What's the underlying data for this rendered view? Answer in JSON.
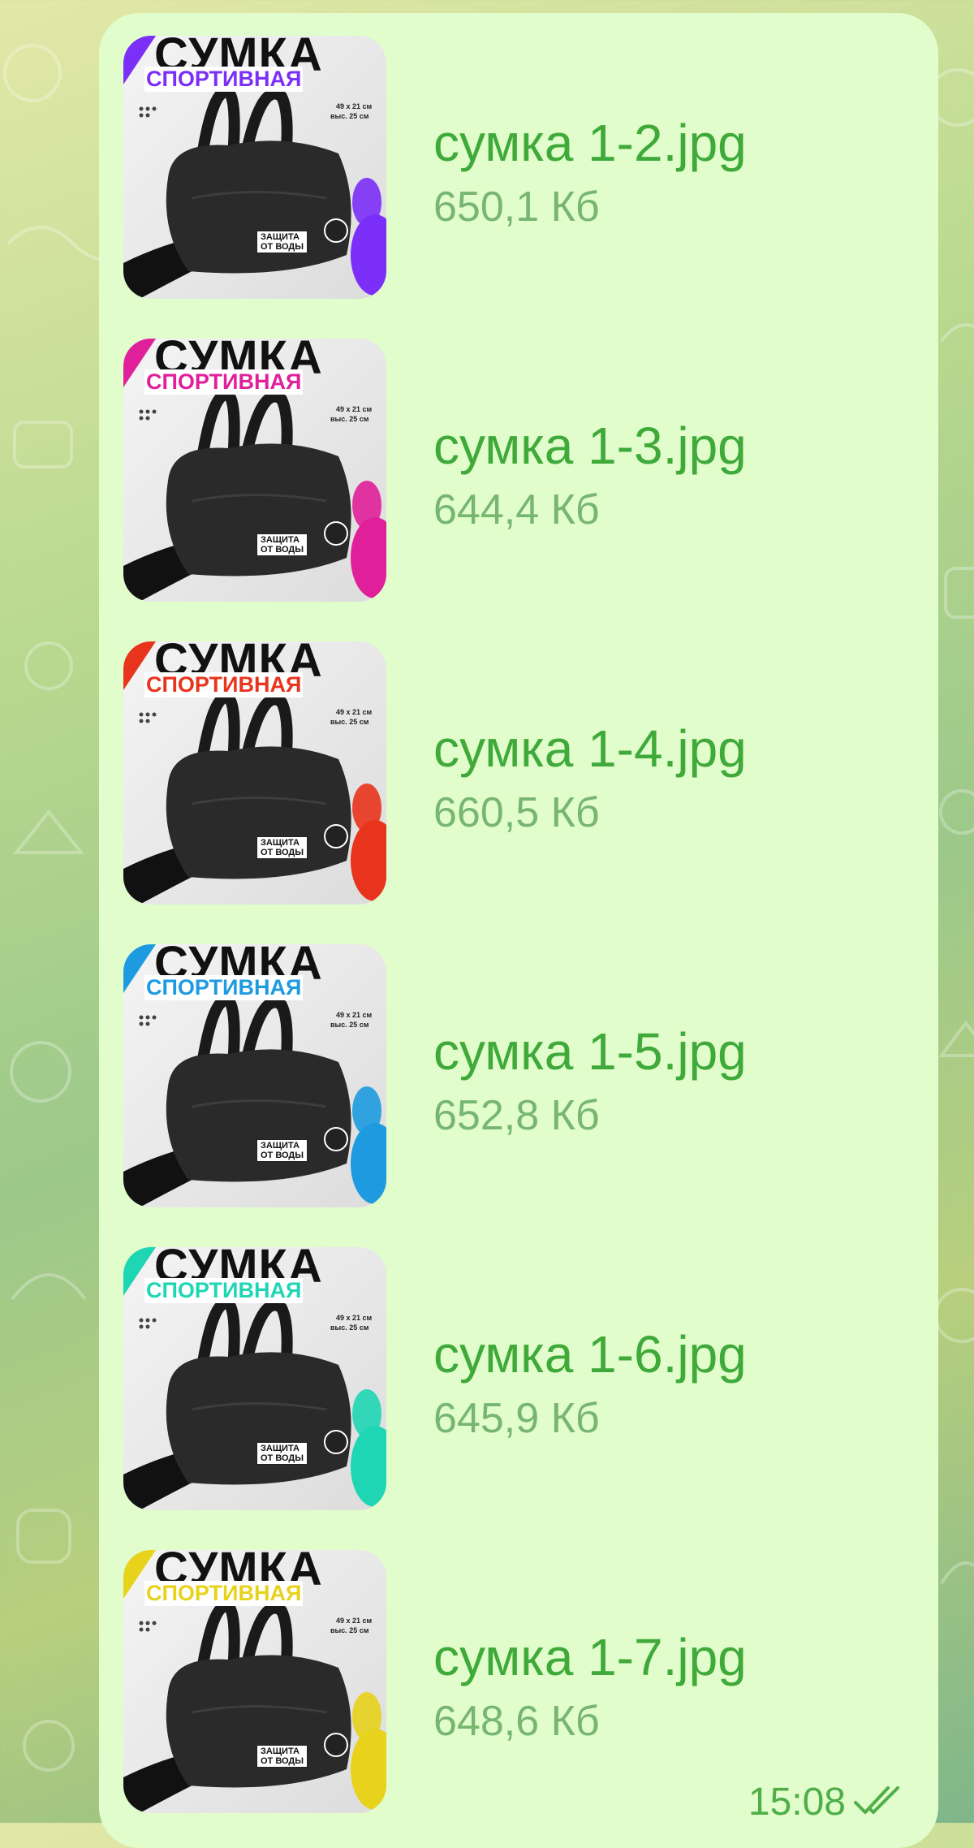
{
  "message": {
    "time": "15:08",
    "status_icon": "double-check-icon",
    "files": [
      {
        "name": "сумка 1-2.jpg",
        "size": "650,1 Кб",
        "thumb_title": "СУМКА",
        "thumb_subtitle": "СПОРТИВНАЯ",
        "thumb_dims": "49 x 21 см",
        "thumb_height": "выс. 25 см",
        "thumb_badge_1": "ЗАЩИТА",
        "thumb_badge_2": "ОТ ВОДЫ",
        "accent": "#7b2ff7"
      },
      {
        "name": "сумка 1-3.jpg",
        "size": "644,4 Кб",
        "thumb_title": "СУМКА",
        "thumb_subtitle": "СПОРТИВНАЯ",
        "thumb_dims": "49 x 21 см",
        "thumb_height": "выс. 25 см",
        "thumb_badge_1": "ЗАЩИТА",
        "thumb_badge_2": "ОТ ВОДЫ",
        "accent": "#e0209a"
      },
      {
        "name": "сумка 1-4.jpg",
        "size": "660,5 Кб",
        "thumb_title": "СУМКА",
        "thumb_subtitle": "СПОРТИВНАЯ",
        "thumb_dims": "49 x 21 см",
        "thumb_height": "выс. 25 см",
        "thumb_badge_1": "ЗАЩИТА",
        "thumb_badge_2": "ОТ ВОДЫ",
        "accent": "#e8341c"
      },
      {
        "name": "сумка 1-5.jpg",
        "size": "652,8 Кб",
        "thumb_title": "СУМКА",
        "thumb_subtitle": "СПОРТИВНАЯ",
        "thumb_dims": "49 x 21 см",
        "thumb_height": "выс. 25 см",
        "thumb_badge_1": "ЗАЩИТА",
        "thumb_badge_2": "ОТ ВОДЫ",
        "accent": "#1e9be0"
      },
      {
        "name": "сумка 1-6.jpg",
        "size": "645,9 Кб",
        "thumb_title": "СУМКА",
        "thumb_subtitle": "СПОРТИВНАЯ",
        "thumb_dims": "49 x 21 см",
        "thumb_height": "выс. 25 см",
        "thumb_badge_1": "ЗАЩИТА",
        "thumb_badge_2": "ОТ ВОДЫ",
        "accent": "#1fd6b4"
      },
      {
        "name": "сумка 1-7.jpg",
        "size": "648,6 Кб",
        "thumb_title": "СУМКА",
        "thumb_subtitle": "СПОРТИВНАЯ",
        "thumb_dims": "49 x 21 см",
        "thumb_height": "выс. 25 см",
        "thumb_badge_1": "ЗАЩИТА",
        "thumb_badge_2": "ОТ ВОДЫ",
        "accent": "#e8d21c"
      }
    ]
  }
}
